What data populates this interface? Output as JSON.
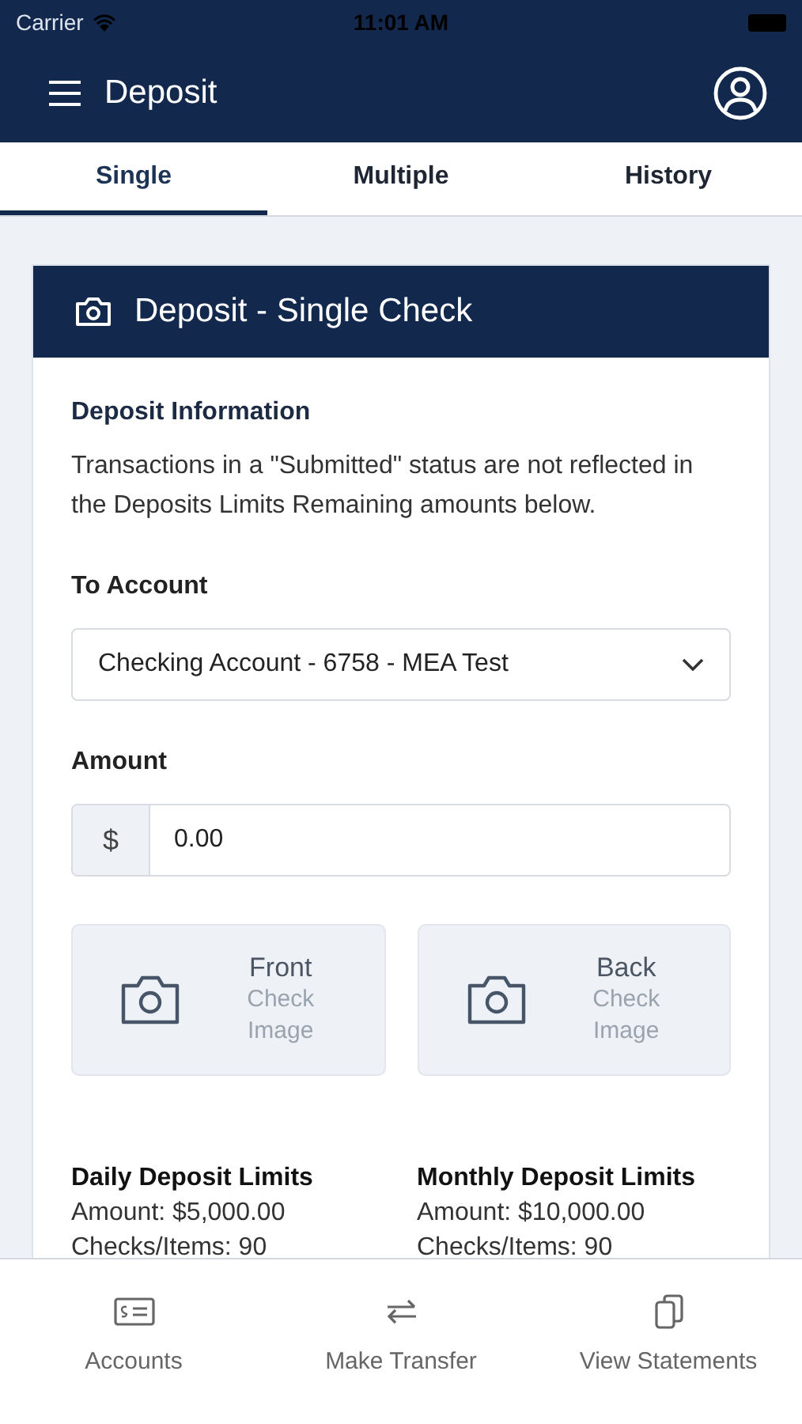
{
  "status_bar": {
    "carrier": "Carrier",
    "time": "11:01 AM"
  },
  "header": {
    "title": "Deposit"
  },
  "tabs": [
    {
      "label": "Single",
      "selected": true
    },
    {
      "label": "Multiple",
      "selected": false
    },
    {
      "label": "History",
      "selected": false
    }
  ],
  "card": {
    "title": "Deposit - Single Check",
    "info_heading": "Deposit Information",
    "info_text": "Transactions in a \"Submitted\" status are not reflected in the Deposits Limits Remaining amounts below.",
    "to_account": {
      "label": "To Account",
      "value": "Checking Account - 6758 - MEA Test"
    },
    "amount": {
      "label": "Amount",
      "prefix": "$",
      "value": "0.00"
    },
    "images": [
      {
        "title": "Front",
        "subtitle": "Check Image"
      },
      {
        "title": "Back",
        "subtitle": "Check Image"
      }
    ],
    "limits": [
      {
        "heading": "Daily Deposit Limits",
        "lines": [
          "Amount: $5,000.00",
          "Checks/Items: 90"
        ]
      },
      {
        "heading": "Monthly Deposit Limits",
        "lines": [
          "Amount: $10,000.00",
          "Checks/Items: 90"
        ]
      }
    ]
  },
  "bottom_nav": [
    {
      "label": "Accounts",
      "kind": "check"
    },
    {
      "label": "Make Transfer",
      "kind": "transfer"
    },
    {
      "label": "View Statements",
      "kind": "copy"
    }
  ]
}
